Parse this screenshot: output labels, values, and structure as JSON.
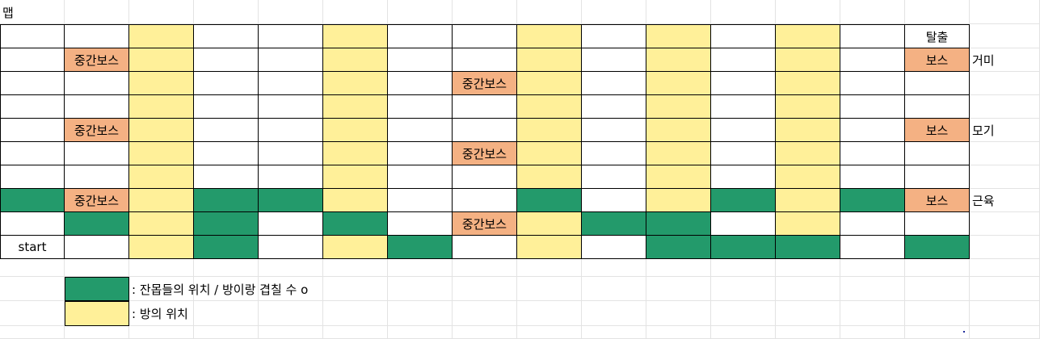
{
  "sheet": {
    "title": "맵",
    "exit_label": "탈출",
    "start_label": "start",
    "midboss_label": "중간보스",
    "boss_label": "보스",
    "side_labels": [
      "거미",
      "모기",
      "근육"
    ]
  },
  "grid": [
    [
      "W",
      "W",
      "Y",
      "W",
      "W",
      "Y",
      "W",
      "W",
      "Y",
      "W",
      "Y",
      "W",
      "Y",
      "W",
      "W"
    ],
    [
      "W",
      "O",
      "Y",
      "W",
      "W",
      "Y",
      "W",
      "W",
      "Y",
      "W",
      "Y",
      "W",
      "Y",
      "W",
      "O"
    ],
    [
      "W",
      "W",
      "Y",
      "W",
      "W",
      "Y",
      "W",
      "O",
      "Y",
      "W",
      "Y",
      "W",
      "Y",
      "W",
      "W"
    ],
    [
      "W",
      "W",
      "Y",
      "W",
      "W",
      "Y",
      "W",
      "W",
      "Y",
      "W",
      "Y",
      "W",
      "Y",
      "W",
      "W"
    ],
    [
      "W",
      "O",
      "Y",
      "W",
      "W",
      "Y",
      "W",
      "W",
      "Y",
      "W",
      "Y",
      "W",
      "Y",
      "W",
      "O"
    ],
    [
      "W",
      "W",
      "Y",
      "W",
      "W",
      "Y",
      "W",
      "O",
      "Y",
      "W",
      "Y",
      "W",
      "Y",
      "W",
      "W"
    ],
    [
      "W",
      "W",
      "Y",
      "W",
      "W",
      "Y",
      "W",
      "W",
      "Y",
      "W",
      "Y",
      "W",
      "Y",
      "W",
      "W"
    ],
    [
      "G",
      "O",
      "Y",
      "G",
      "G",
      "Y",
      "W",
      "W",
      "G",
      "W",
      "Y",
      "G",
      "Y",
      "G",
      "O"
    ],
    [
      "W",
      "G",
      "Y",
      "G",
      "W",
      "G",
      "W",
      "O",
      "Y",
      "G",
      "G",
      "W",
      "Y",
      "W",
      "W"
    ],
    [
      "W",
      "W",
      "Y",
      "G",
      "W",
      "Y",
      "G",
      "W",
      "Y",
      "W",
      "G",
      "G",
      "G",
      "W",
      "G"
    ]
  ],
  "legend": {
    "green_text": ": 잔몹들의 위치 / 방이랑 겹칠 수 o",
    "yellow_text": ": 방의 위치"
  },
  "colors": {
    "green": "#239a6b",
    "yellow": "#fff099",
    "orange": "#f4b183",
    "gridline": "#e3e3e3"
  }
}
